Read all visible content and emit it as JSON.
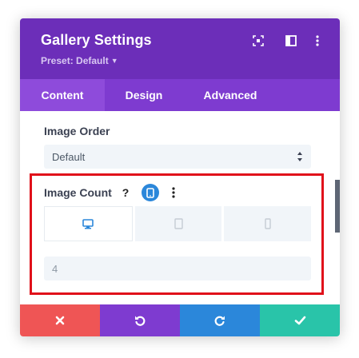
{
  "header": {
    "title": "Gallery Settings",
    "preset_label": "Preset: Default",
    "icons": [
      "expand-icon",
      "sidebar-layout-icon",
      "more-options-icon"
    ]
  },
  "tabs": [
    {
      "label": "Content",
      "active": true
    },
    {
      "label": "Design",
      "active": false
    },
    {
      "label": "Advanced",
      "active": false
    }
  ],
  "image_order": {
    "label": "Image Order",
    "value": "Default"
  },
  "image_count": {
    "label": "Image Count",
    "help_symbol": "?",
    "icons": [
      "help-icon",
      "responsive-phone-icon",
      "more-options-icon"
    ],
    "devices": [
      {
        "icon": "desktop-icon",
        "active": true
      },
      {
        "icon": "tablet-icon",
        "active": false
      },
      {
        "icon": "phone-icon",
        "active": false
      }
    ],
    "value": "4"
  },
  "footer": {
    "buttons": [
      {
        "icon": "close-icon",
        "color": "#ef5555"
      },
      {
        "icon": "undo-icon",
        "color": "#7e3bd0"
      },
      {
        "icon": "redo-icon",
        "color": "#2b87da"
      },
      {
        "icon": "check-icon",
        "color": "#29c4a9"
      }
    ]
  },
  "colors": {
    "header": "#6c2eb9",
    "tabs": "#7e3bd0",
    "active_tab": "#8e4bdb",
    "highlight_border": "#e0101a",
    "accent_blue": "#2b87da"
  }
}
